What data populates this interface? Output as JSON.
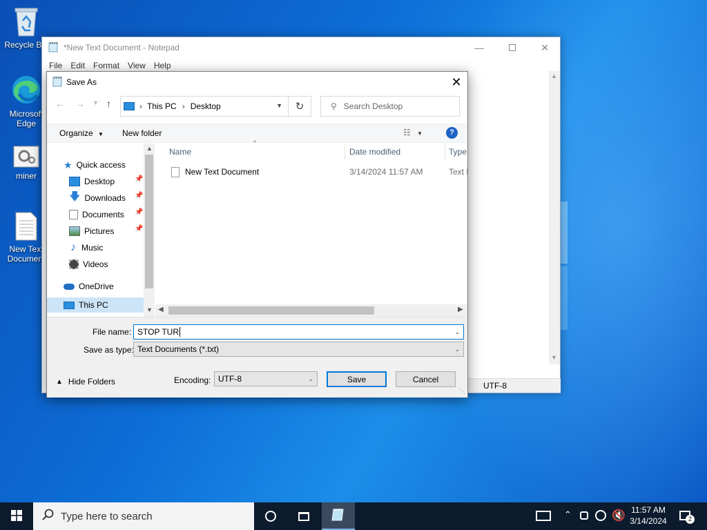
{
  "desktop": {
    "icons": [
      {
        "label": "Recycle Bin",
        "icon": "recycle-bin-icon"
      },
      {
        "label": "Microsoft Edge",
        "icon": "edge-icon"
      },
      {
        "label": "miner",
        "icon": "settings-file-icon"
      },
      {
        "label": "New Text Document",
        "icon": "text-file-icon"
      }
    ]
  },
  "notepad": {
    "title": "*New Text Document - Notepad",
    "menu": [
      "File",
      "Edit",
      "Format",
      "View",
      "Help"
    ],
    "status_encoding": "UTF-8"
  },
  "dialog": {
    "title": "Save As",
    "address": {
      "segments": [
        "This PC",
        "Desktop"
      ]
    },
    "search_placeholder": "Search Desktop",
    "toolbar": {
      "organize": "Organize",
      "new_folder": "New folder"
    },
    "nav": {
      "quick_access": "Quick access",
      "items": [
        {
          "label": "Desktop",
          "icon": "desktop-folder-icon",
          "pinned": true
        },
        {
          "label": "Downloads",
          "icon": "download-arrow-icon",
          "pinned": true
        },
        {
          "label": "Documents",
          "icon": "documents-icon",
          "pinned": true
        },
        {
          "label": "Pictures",
          "icon": "pictures-icon",
          "pinned": true
        },
        {
          "label": "Music",
          "icon": "music-note-icon",
          "pinned": false
        },
        {
          "label": "Videos",
          "icon": "film-strip-icon",
          "pinned": false
        }
      ],
      "onedrive": "OneDrive",
      "this_pc": "This PC"
    },
    "columns": {
      "name": "Name",
      "date": "Date modified",
      "type": "Type"
    },
    "files": [
      {
        "name": "New Text Document",
        "date": "3/14/2024 11:57 AM",
        "type": "Text D"
      }
    ],
    "file_name_label": "File name:",
    "file_name_value": "STOP TUR",
    "save_type_label": "Save as type:",
    "save_type_value": "Text Documents (*.txt)",
    "hide_folders": "Hide Folders",
    "encoding_label": "Encoding:",
    "encoding_value": "UTF-8",
    "save_button": "Save",
    "cancel_button": "Cancel"
  },
  "taskbar": {
    "search_placeholder": "Type here to search",
    "time": "11:57 AM",
    "date": "3/14/2024",
    "notification_count": "2"
  }
}
